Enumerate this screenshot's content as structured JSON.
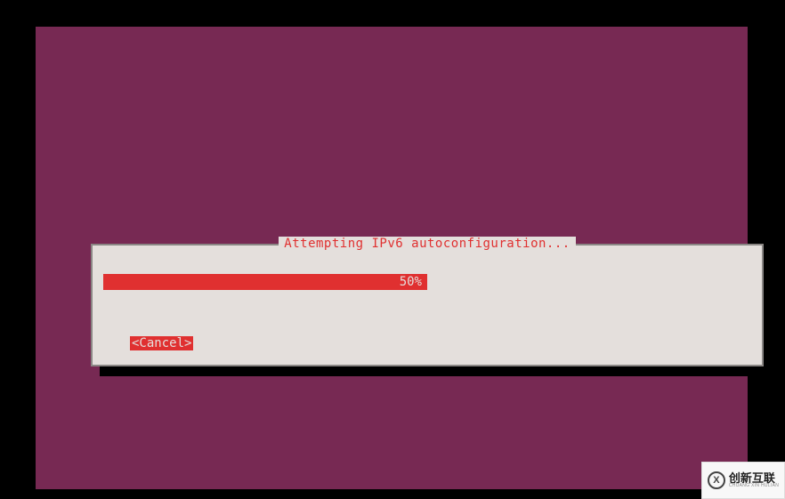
{
  "dialog": {
    "title": "Attempting IPv6 autoconfiguration...",
    "progress_percent": 50,
    "progress_label": "50%",
    "cancel_label": "<Cancel>"
  },
  "colors": {
    "background": "#772953",
    "dialog_bg": "#e4dfdc",
    "accent_red": "#e03030",
    "border_grey": "#8a8684"
  },
  "watermark": {
    "icon_text": "X",
    "main": "创新互联",
    "sub": "CHUANG XIN HULIAN"
  }
}
